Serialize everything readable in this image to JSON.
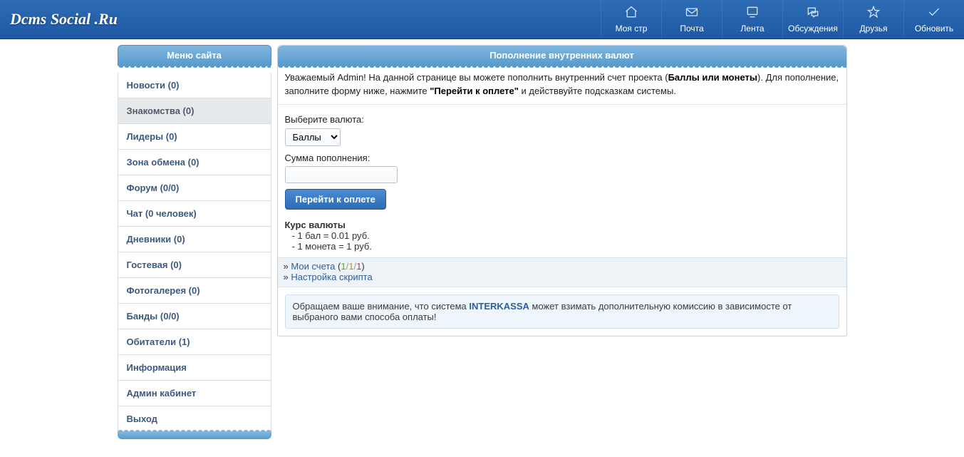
{
  "site_title": "Dcms Social .Ru",
  "topnav": [
    {
      "key": "mypage",
      "label": "Моя стр"
    },
    {
      "key": "mail",
      "label": "Почта"
    },
    {
      "key": "feed",
      "label": "Лента"
    },
    {
      "key": "talks",
      "label": "Обсуждения"
    },
    {
      "key": "friends",
      "label": "Друзья"
    },
    {
      "key": "refresh",
      "label": "Обновить"
    }
  ],
  "sidebar": {
    "title": "Меню сайта",
    "items": [
      {
        "label": "Новости (0)"
      },
      {
        "label": "Знакомства (0)",
        "active": true
      },
      {
        "label": "Лидеры (0)"
      },
      {
        "label": "Зона обмена (0)"
      },
      {
        "label": "Форум (0/0)"
      },
      {
        "label": "Чат (0 человек)"
      },
      {
        "label": "Дневники (0)"
      },
      {
        "label": "Гостевая (0)"
      },
      {
        "label": "Фотогалерея (0)"
      },
      {
        "label": "Банды (0/0)"
      },
      {
        "label": "Обитатели (1)"
      },
      {
        "label": "Информация"
      },
      {
        "label": "Админ кабинет"
      },
      {
        "label": "Выход"
      }
    ]
  },
  "main": {
    "title": "Пополнение внутренних валют",
    "intro_pre": "Уважаемый Admin! На данной странице вы можете пополнить внутренний счет проекта (",
    "intro_bold1": "Баллы или монеты",
    "intro_mid": "). Для пополнение, заполните форму ниже, нажмите ",
    "intro_bold2": "\"Перейти к оплете\"",
    "intro_post": " и действвуйте подсказкам системы.",
    "currency_label": "Выберите валюта:",
    "currency_options": [
      "Баллы"
    ],
    "currency_selected": "Баллы",
    "amount_label": "Сумма пополнения:",
    "amount_value": "",
    "submit_label": "Перейти к оплете",
    "rates_title": "Курс валюты",
    "rate_lines": [
      "- 1 бал = 0.01 руб.",
      "- 1 монета = 1 руб."
    ],
    "links": {
      "raquo": "»",
      "accounts_label": "Мои счета",
      "accounts_counts": {
        "n1": "1",
        "n2": "1",
        "n3": "1"
      },
      "settings_label": "Настройка скрипта"
    },
    "notice_pre": "Обращаем ваше внимание, что система ",
    "notice_kw": "INTERKASSA",
    "notice_post": " может взимать дополнительную комиссию в зависимосте от выбраного вами способа оплаты!"
  }
}
